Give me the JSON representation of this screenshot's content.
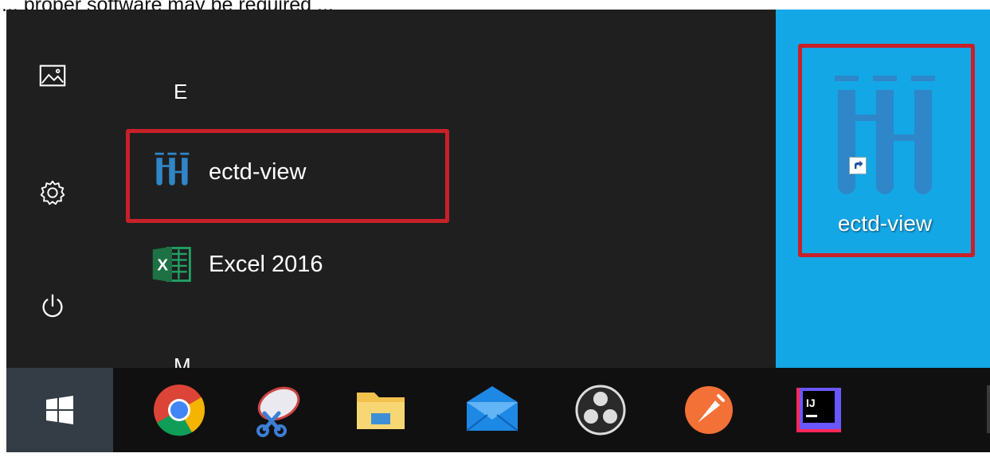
{
  "caption": {
    "text": "... proper software may be required ..."
  },
  "start_menu": {
    "rail_icons": [
      "pictures-icon",
      "settings-gear-icon",
      "power-icon"
    ],
    "groups": [
      {
        "letter": "E"
      },
      {
        "letter": "M"
      }
    ],
    "apps": [
      {
        "label": "ectd-view",
        "icon": "ectd-view-icon",
        "highlighted": true
      },
      {
        "label": "Excel 2016",
        "icon": "excel-icon",
        "highlighted": false
      }
    ]
  },
  "tiles": {
    "items": [
      {
        "label": "ectd-view",
        "icon": "ectd-view-icon",
        "highlighted": true
      }
    ]
  },
  "taskbar": {
    "start_icon": "windows-logo-icon",
    "apps": [
      "chrome-icon",
      "snipping-tool-icon",
      "file-explorer-icon",
      "mail-icon",
      "obs-icon",
      "postman-icon",
      "intellij-icon"
    ]
  },
  "colors": {
    "highlight": "#c8202a",
    "tile_bg": "#14a7e6",
    "menu_bg": "#1f1f1f",
    "ectd_icon": "#2f86c8"
  }
}
